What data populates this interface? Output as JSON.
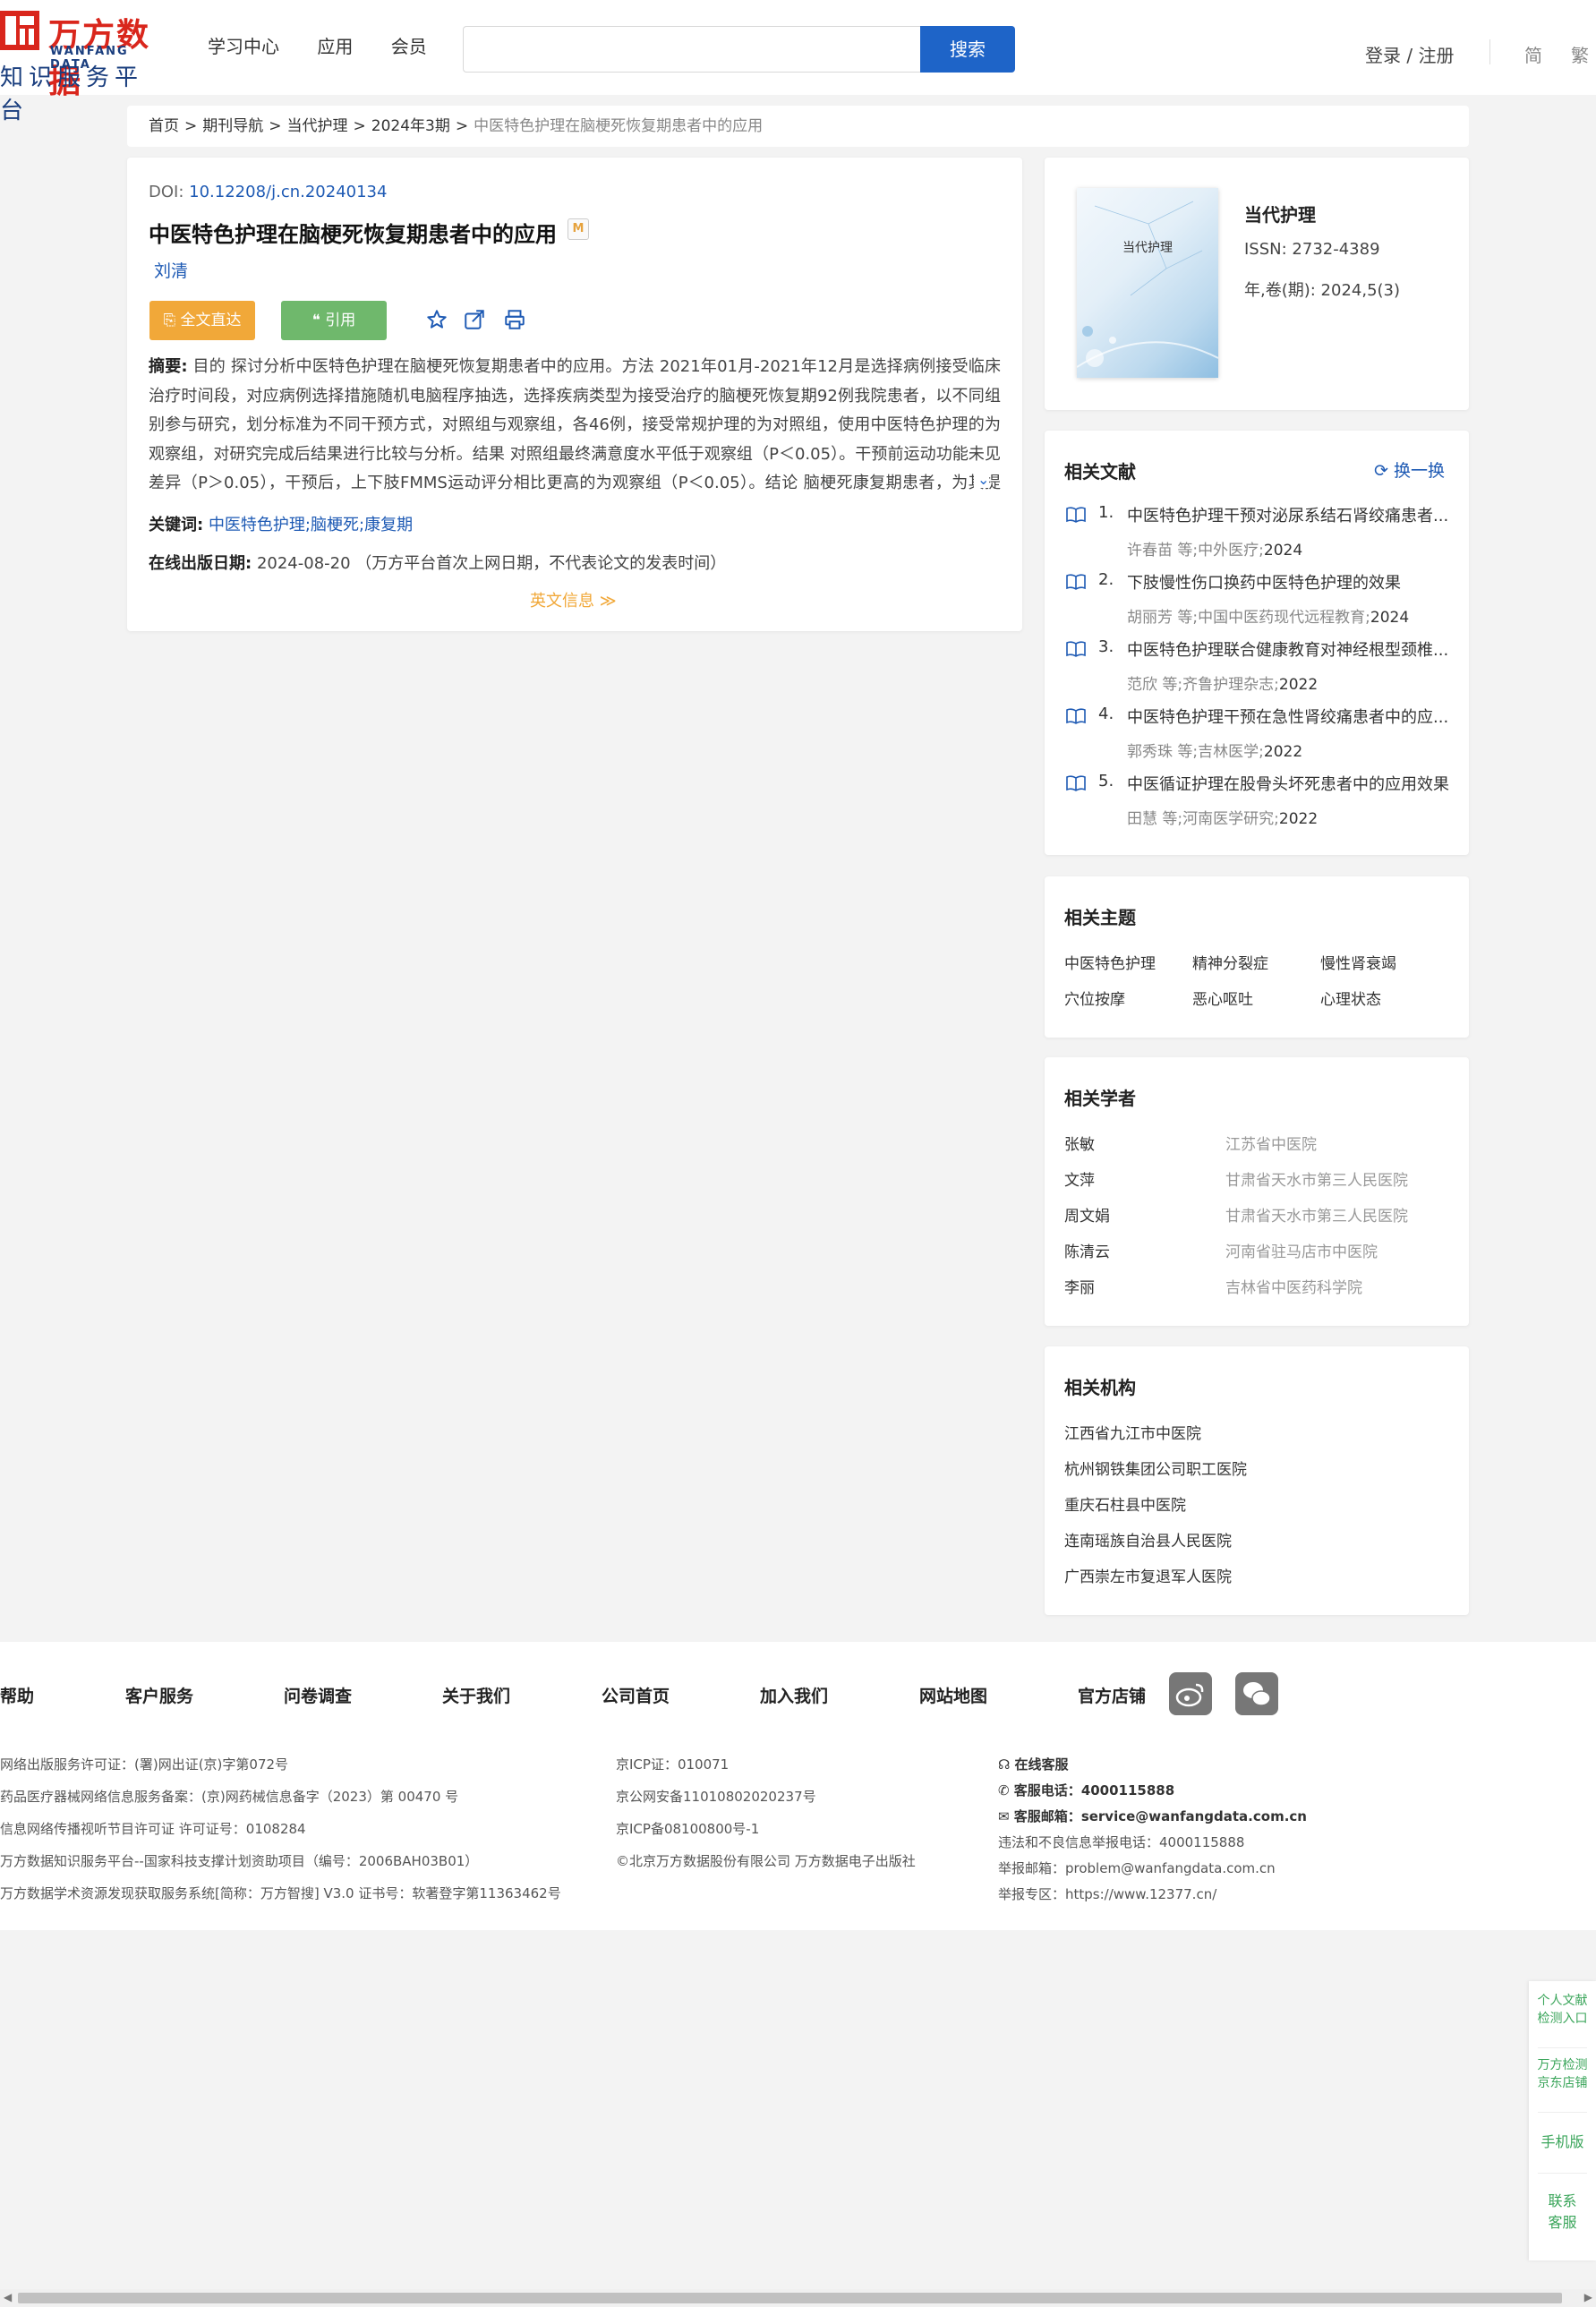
{
  "header": {
    "logo_cn": "万方数据",
    "logo_en": "WANFANG DATA",
    "logo_sub": "知识服务平台",
    "nav": [
      "学习中心",
      "应用",
      "会员"
    ],
    "search_placeholder": "",
    "search_button": "搜索",
    "login": "登录 / 注册",
    "lang_simplified": "简",
    "lang_traditional": "繁"
  },
  "breadcrumb": {
    "items": [
      "首页",
      "期刊导航",
      "当代护理",
      "2024年3期"
    ],
    "current": "中医特色护理在脑梗死恢复期患者中的应用",
    "separator": ">"
  },
  "article": {
    "doi_label": "DOI:",
    "doi": "10.12208/j.cn.20240134",
    "title": "中医特色护理在脑梗死恢复期患者中的应用",
    "badge": "M",
    "author": "刘清",
    "btn_fulltext": "全文直达",
    "btn_cite": "引用",
    "abstract_label": "摘要:",
    "abstract": "目的 探讨分析中医特色护理在脑梗死恢复期患者中的应用。方法 2021年01月-2021年12月是选择病例接受临床治疗时间段，对应病例选择措施随机电脑程序抽选，选择疾病类型为接受治疗的脑梗死恢复期92例我院患者，以不同组别参与研究，划分标准为不同干预方式，对照组与观察组，各46例，接受常规护理的为对照组，使用中医特色护理的为观察组，对研究完成后结果进行比较与分析。结果 对照组最终满意度水平低于观察组（P＜0.05）。干预前运动功能未见差异（P＞0.05），干预后，上下肢FMMS运动评分相比更高的为观察组（P＜0.05）。结论 脑梗死康复期患者，为其提供中医特...",
    "keywords_label": "关键词:",
    "keywords": [
      "中医特色护理;",
      "脑梗死;",
      "康复期"
    ],
    "pubdate_label": "在线出版日期:",
    "pubdate": "2024-08-20",
    "pubdate_note": "（万方平台首次上网日期，不代表论文的发表时间）",
    "english_info": "英文信息"
  },
  "journal": {
    "cover_title": "当代护理",
    "name": "当代护理",
    "issn": "ISSN:  2732-4389",
    "volume": "年,卷(期):  2024,5(3)"
  },
  "related_literature": {
    "title": "相关文献",
    "refresh": "换一换",
    "items": [
      {
        "num": "1.",
        "title": "中医特色护理干预对泌尿系结石肾绞痛患者...",
        "authors": "许春苗  等;",
        "journal": "中外医疗;",
        "year": "2024"
      },
      {
        "num": "2.",
        "title": "下肢慢性伤口换药中医特色护理的效果",
        "authors": "胡丽芳  等;",
        "journal": "中国中医药现代远程教育;",
        "year": "2024"
      },
      {
        "num": "3.",
        "title": "中医特色护理联合健康教育对神经根型颈椎...",
        "authors": "范欣  等;",
        "journal": "齐鲁护理杂志;",
        "year": "2022"
      },
      {
        "num": "4.",
        "title": "中医特色护理干预在急性肾绞痛患者中的应...",
        "authors": "郭秀珠  等;",
        "journal": "吉林医学;",
        "year": "2022"
      },
      {
        "num": "5.",
        "title": "中医循证护理在股骨头坏死患者中的应用效果",
        "authors": "田慧  等;",
        "journal": "河南医学研究;",
        "year": "2022"
      }
    ]
  },
  "related_topics": {
    "title": "相关主题",
    "items": [
      "中医特色护理",
      "精神分裂症",
      "慢性肾衰竭",
      "穴位按摩",
      "恶心呕吐",
      "心理状态"
    ]
  },
  "related_scholars": {
    "title": "相关学者",
    "items": [
      {
        "name": "张敏",
        "inst": "江苏省中医院"
      },
      {
        "name": "文萍",
        "inst": "甘肃省天水市第三人民医院"
      },
      {
        "name": "周文娟",
        "inst": "甘肃省天水市第三人民医院"
      },
      {
        "name": "陈清云",
        "inst": "河南省驻马店市中医院"
      },
      {
        "name": "李丽",
        "inst": "吉林省中医药科学院"
      }
    ]
  },
  "related_institutions": {
    "title": "相关机构",
    "items": [
      "江西省九江市中医院",
      "杭州钢铁集团公司职工医院",
      "重庆石柱县中医院",
      "连南瑶族自治县人民医院",
      "广西崇左市复退军人医院"
    ]
  },
  "footer": {
    "links": [
      "帮助",
      "客户服务",
      "问卷调查",
      "关于我们",
      "公司首页",
      "加入我们",
      "网站地图",
      "官方店铺"
    ],
    "col1": [
      "网络出版服务许可证：(署)网出证(京)字第072号",
      "药品医疗器械网络信息服务备案：(京)网药械信息备字（2023）第 00470 号",
      "信息网络传播视听节目许可证 许可证号：0108284",
      "万方数据知识服务平台--国家科技支撑计划资助项目（编号：2006BAH03B01）",
      "万方数据学术资源发现获取服务系统[简称：万方智搜] V3.0 证书号：软著登字第11363462号"
    ],
    "col2": [
      "京ICP证：010071",
      "京公网安备11010802020237号",
      "京ICP备08100800号-1",
      "©北京万方数据股份有限公司 万方数据电子出版社"
    ],
    "online_service": "在线客服",
    "phone_label": "客服电话：",
    "phone": "4000115888",
    "email_label": "客服邮箱：",
    "email": "service@wanfangdata.com.cn",
    "report_phone": "违法和不良信息举报电话：4000115888",
    "report_email": "举报邮箱：problem@wanfangdata.com.cn",
    "report_site": "举报专区：https://www.12377.cn/"
  },
  "side_float": {
    "item1": "个人文献检测入口",
    "item2": "万方检测京东店铺",
    "item3": "手机版",
    "item4": "联系客服"
  },
  "colors": {
    "brand_blue": "#1e64c8",
    "link_blue": "#1e5ab4",
    "orange": "#f1a839",
    "green": "#6fb86c"
  }
}
